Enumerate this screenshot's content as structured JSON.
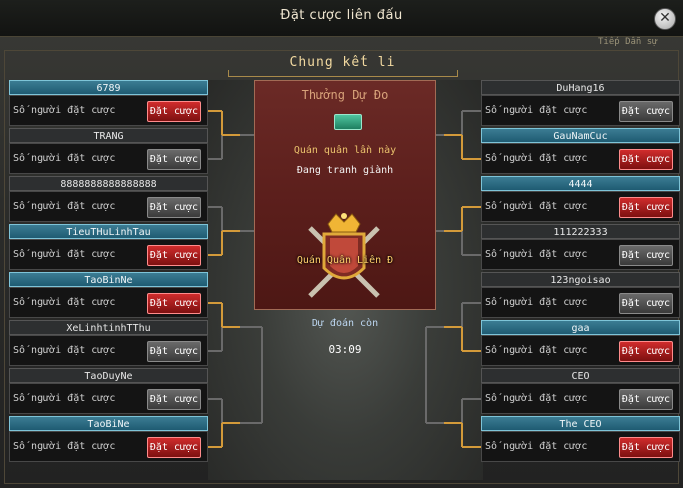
{
  "window": {
    "title": "Đặt cược liên đấu",
    "top_right_hint": "Tiếp Dẫn sự"
  },
  "round": "Chung kết li",
  "reward": {
    "title": "Thưởng Dự Đo",
    "icon": "reward-chest-icon",
    "champion_label": "Quán quân lần này",
    "champion_status": "Đang tranh giành",
    "emblem_label": "Quán Quân Liên Đ"
  },
  "prediction": {
    "label": "Dự đoán còn",
    "timer": "03:09"
  },
  "labels": {
    "count": "Số người đặt cược",
    "bet": "Đặt cược"
  },
  "left": [
    {
      "name": "6789",
      "highlight": true,
      "bet_active": true
    },
    {
      "name": "TRANG",
      "highlight": false,
      "bet_active": false
    },
    {
      "name": "8888888888888888",
      "highlight": false,
      "bet_active": false
    },
    {
      "name": "TieuTHuLinhTau",
      "highlight": true,
      "bet_active": true
    },
    {
      "name": "TaoBinNe",
      "highlight": true,
      "bet_active": true
    },
    {
      "name": "XeLinhtinhTThu",
      "highlight": false,
      "bet_active": false
    },
    {
      "name": "TaoDuyNe",
      "highlight": false,
      "bet_active": false
    },
    {
      "name": "TaoBiNe",
      "highlight": true,
      "bet_active": true
    }
  ],
  "right": [
    {
      "name": "DuHang16",
      "highlight": false,
      "bet_active": false
    },
    {
      "name": "GauNamCuc",
      "highlight": true,
      "bet_active": true
    },
    {
      "name": "4444",
      "highlight": true,
      "bet_active": true
    },
    {
      "name": "111222333",
      "highlight": false,
      "bet_active": false
    },
    {
      "name": "123ngoisao",
      "highlight": false,
      "bet_active": false
    },
    {
      "name": "gaa",
      "highlight": true,
      "bet_active": true
    },
    {
      "name": "CEO",
      "highlight": false,
      "bet_active": false
    },
    {
      "name": "The CEO",
      "highlight": true,
      "bet_active": true
    }
  ],
  "colors": {
    "bracket_gold": "#d39a3a",
    "bracket_gray": "#6a6a6a",
    "highlight": "#2f6f86",
    "bet_red": "#b81f1f"
  }
}
